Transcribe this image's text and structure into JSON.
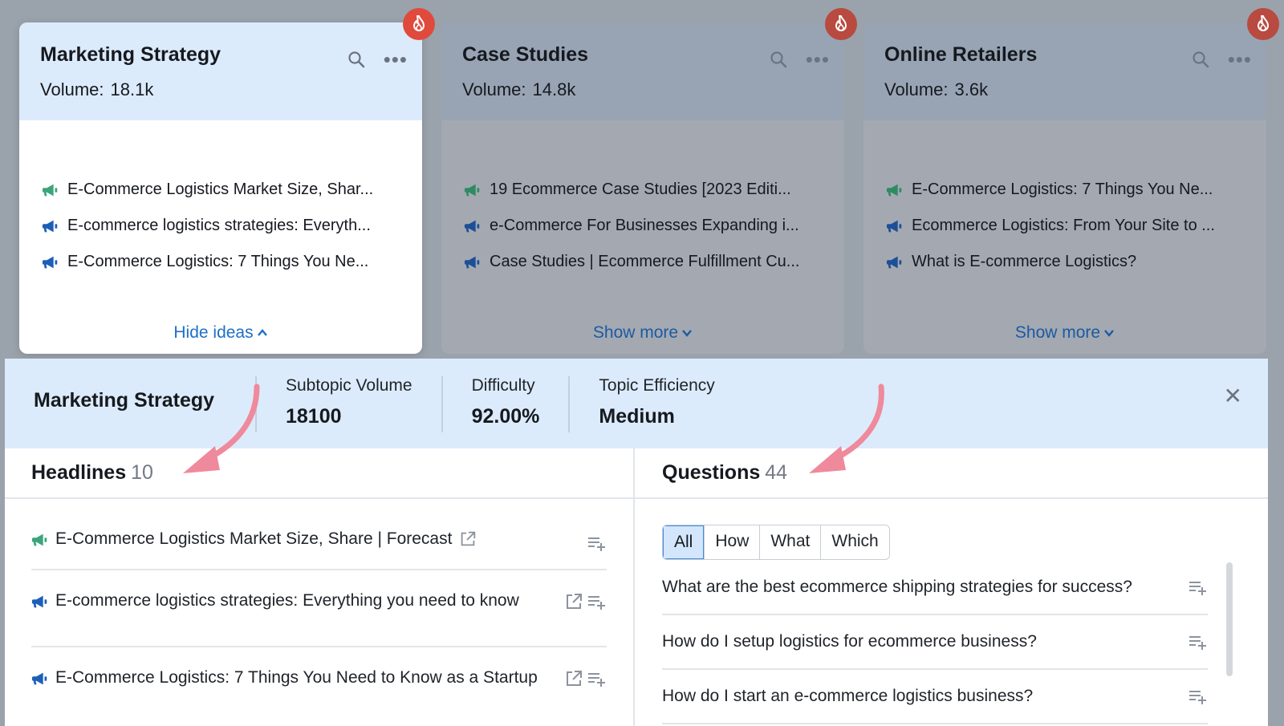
{
  "cards": [
    {
      "title": "Marketing Strategy",
      "volume_label": "Volume:",
      "volume": "18.1k",
      "ideas": [
        {
          "icon": "megaphone-green-icon",
          "text": "E-Commerce Logistics Market Size, Shar..."
        },
        {
          "icon": "megaphone-blue-icon",
          "text": "E-commerce logistics strategies: Everyth..."
        },
        {
          "icon": "megaphone-blue-icon",
          "text": "E-Commerce Logistics: 7 Things You Ne..."
        }
      ],
      "footer": "Hide ideas"
    },
    {
      "title": "Case Studies",
      "volume_label": "Volume:",
      "volume": "14.8k",
      "ideas": [
        {
          "icon": "megaphone-green-icon",
          "text": "19 Ecommerce Case Studies [2023 Editi..."
        },
        {
          "icon": "megaphone-blue-icon",
          "text": "e-Commerce For Businesses Expanding i..."
        },
        {
          "icon": "megaphone-blue-icon",
          "text": "Case Studies | Ecommerce Fulfillment Cu..."
        }
      ],
      "footer": "Show more"
    },
    {
      "title": "Online Retailers",
      "volume_label": "Volume:",
      "volume": "3.6k",
      "ideas": [
        {
          "icon": "megaphone-green-icon",
          "text": "E-Commerce Logistics: 7 Things You Ne..."
        },
        {
          "icon": "megaphone-blue-icon",
          "text": "Ecommerce Logistics: From Your Site to ..."
        },
        {
          "icon": "megaphone-blue-icon",
          "text": "What is E-commerce Logistics?"
        }
      ],
      "footer": "Show more"
    }
  ],
  "panel": {
    "title": "Marketing Strategy",
    "stats": [
      {
        "label": "Subtopic Volume",
        "value": "18100"
      },
      {
        "label": "Difficulty",
        "value": "92.00%"
      },
      {
        "label": "Topic Efficiency",
        "value": "Medium"
      }
    ],
    "headlines": {
      "title": "Headlines",
      "count": "10",
      "items": [
        {
          "icon": "megaphone-green-icon",
          "text": "E-Commerce Logistics Market Size, Share | Forecast"
        },
        {
          "icon": "megaphone-blue-icon",
          "text": "E-commerce logistics strategies: Everything you need to know"
        },
        {
          "icon": "megaphone-blue-icon",
          "text": "E-Commerce Logistics: 7 Things You Need to Know as a Startup"
        }
      ]
    },
    "questions": {
      "title": "Questions",
      "count": "44",
      "filters": [
        "All",
        "How",
        "What",
        "Which"
      ],
      "active_filter": "All",
      "items": [
        "What are the best ecommerce shipping strategies for success?",
        "How do I setup logistics for ecommerce business?",
        "How do I start an e-commerce logistics business?"
      ]
    }
  },
  "colors": {
    "accent_blue": "#1e6fc8",
    "megaphone_green": "#3aa57a",
    "megaphone_blue": "#1d5fb8",
    "fire_red": "#e04a3c",
    "annotation_pink": "#ee8a9c"
  }
}
